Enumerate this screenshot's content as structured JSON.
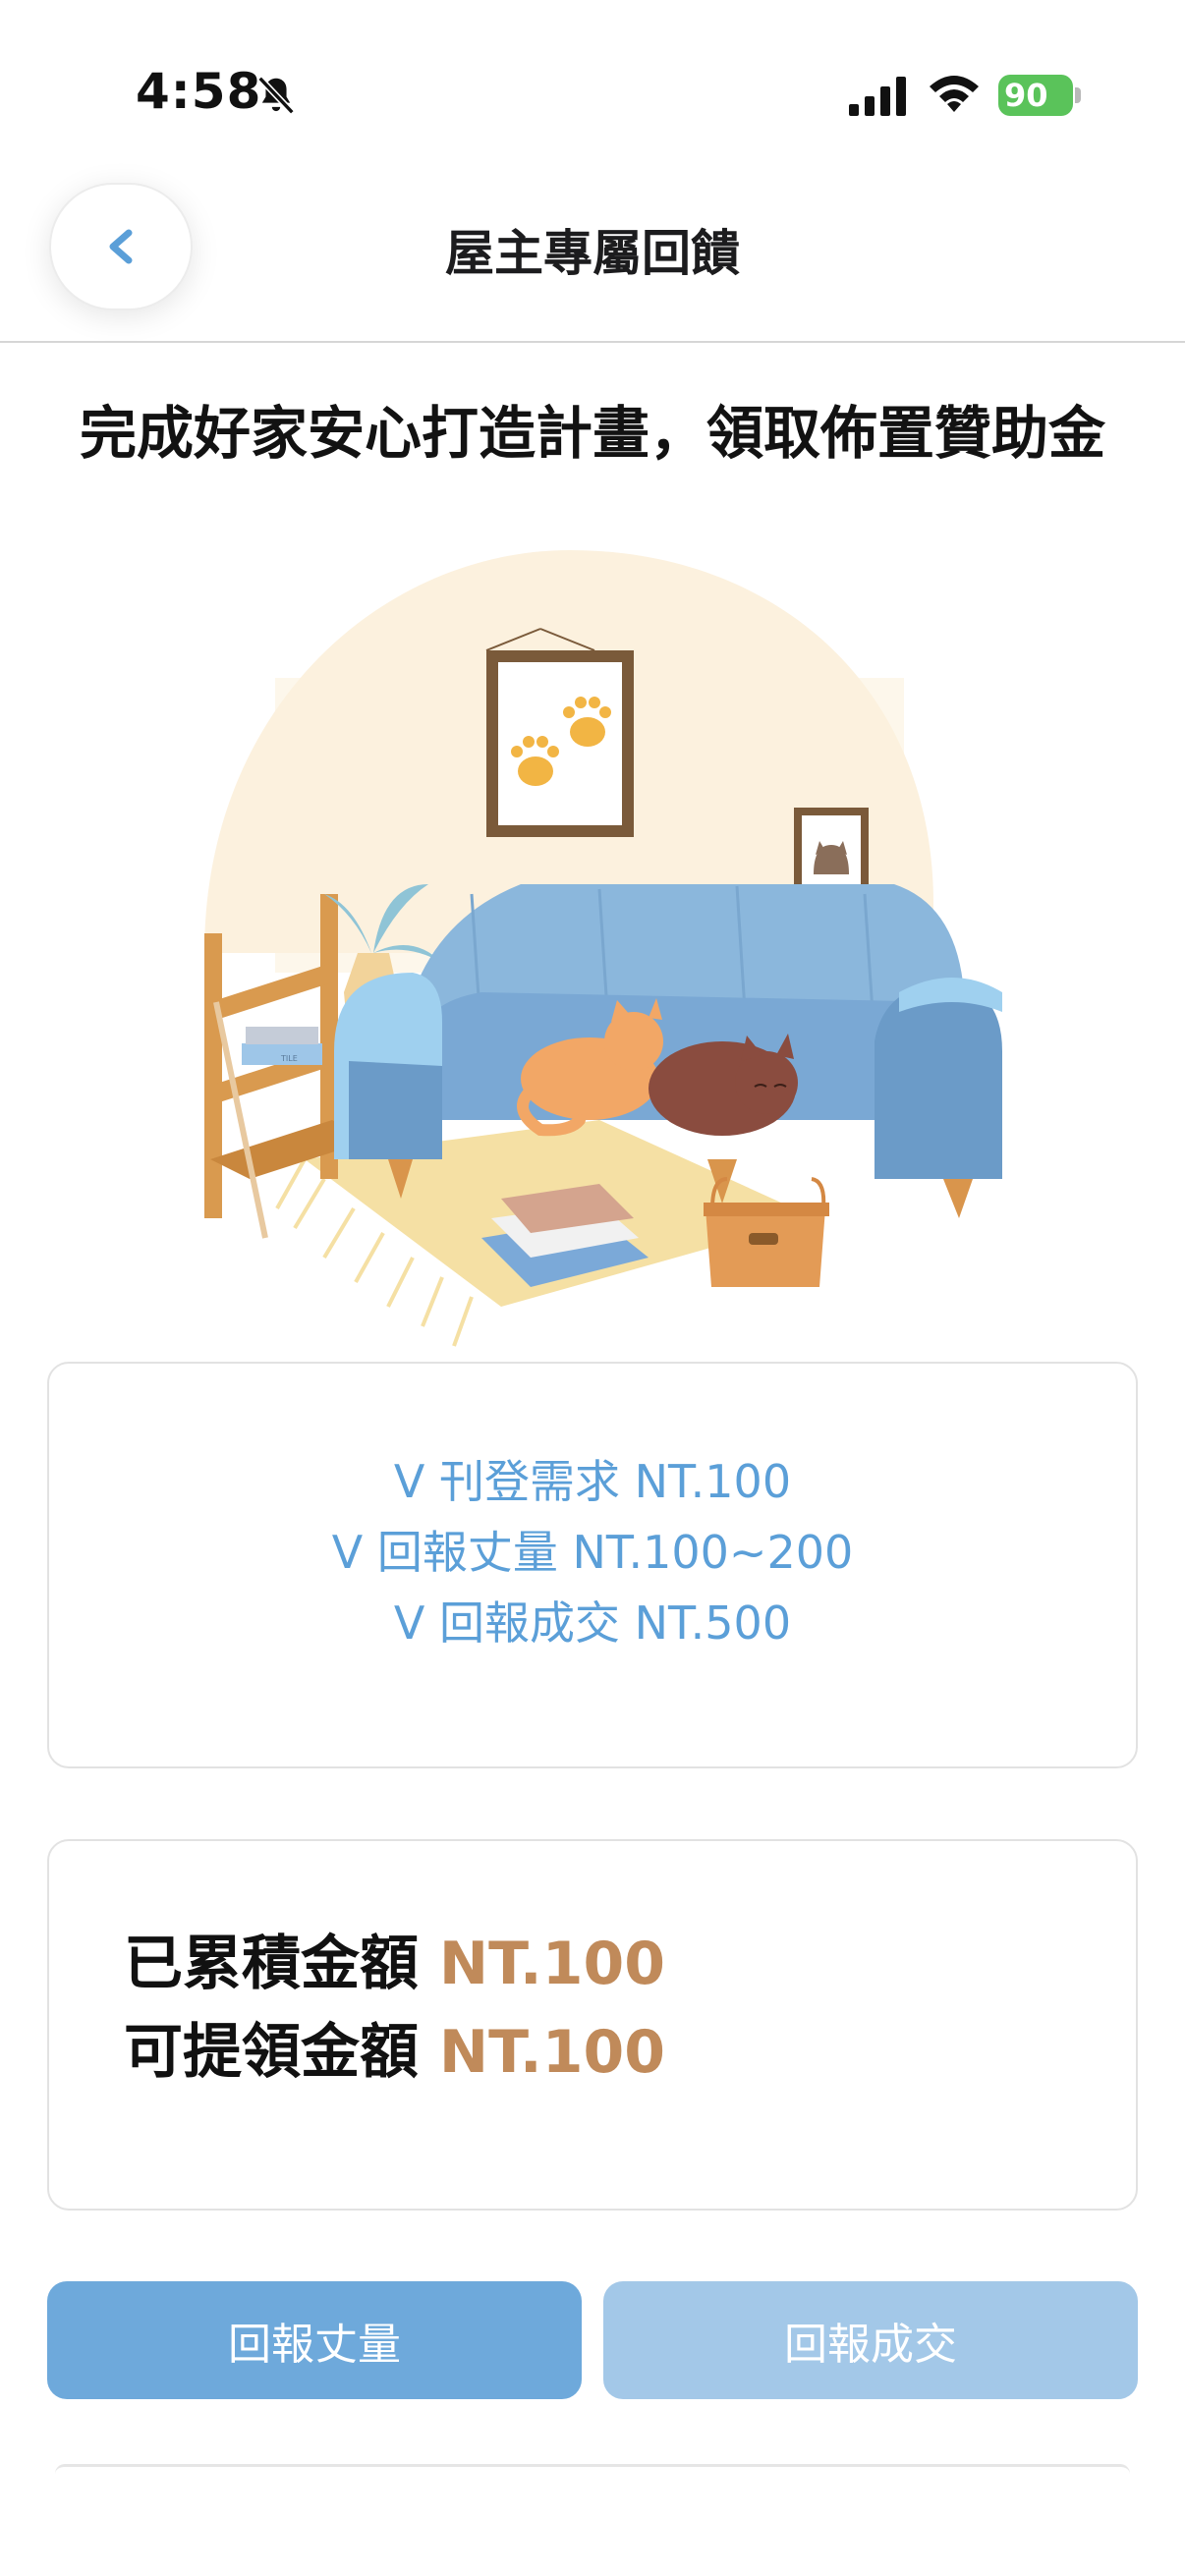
{
  "status_bar": {
    "time": "4:58",
    "battery": "90"
  },
  "nav": {
    "title": "屋主專屬回饋"
  },
  "headline": "完成好家安心打造計畫，領取佈置贊助金",
  "illustration": {
    "book_spine_text": "TILE"
  },
  "rewards": [
    "V 刊登需求 NT.100",
    "V 回報丈量 NT.100~200",
    "V 回報成交 NT.500"
  ],
  "amounts": {
    "accumulated_label": "已累積金額",
    "accumulated_value": "NT.100",
    "withdrawable_label": "可提領金額",
    "withdrawable_value": "NT.100"
  },
  "buttons": {
    "report_measure": "回報丈量",
    "report_deal": "回報成交"
  },
  "colors": {
    "accent_blue": "#6ea9db",
    "accent_blue_disabled": "#a3c8e8",
    "reward_text": "#5b9fd8",
    "amount_value": "#c08a5a",
    "battery_green": "#5ac35a"
  }
}
